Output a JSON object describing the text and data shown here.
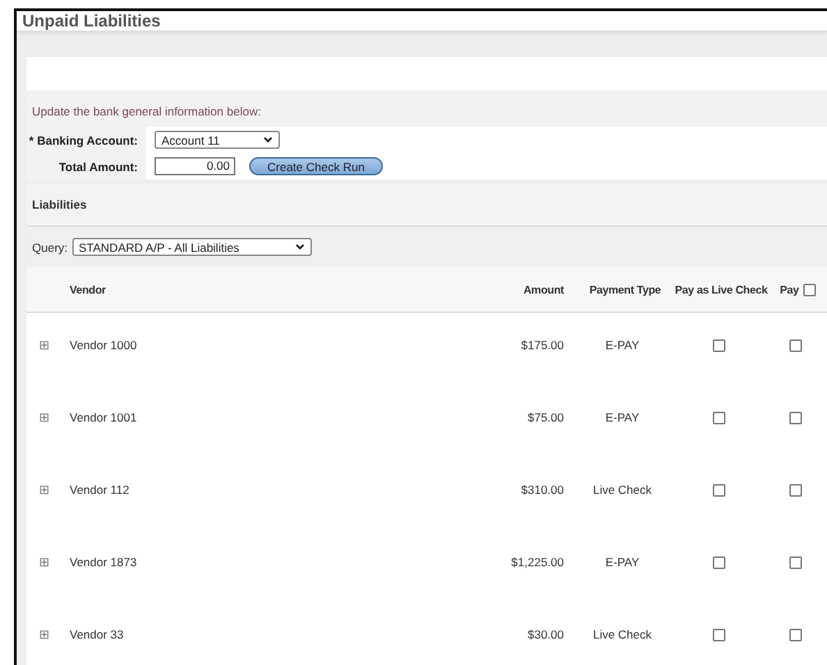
{
  "window": {
    "title": "Unpaid Liabilities"
  },
  "form": {
    "intro": "Update the bank general information below:",
    "banking_account": {
      "label": "* Banking Account:",
      "value": "Account 11"
    },
    "total_amount": {
      "label": "Total Amount:",
      "value": "0.00"
    },
    "create_button": "Create Check Run"
  },
  "section_title": "Liabilities",
  "query": {
    "label": "Query:",
    "value": "STANDARD A/P - All Liabilities"
  },
  "table": {
    "columns": [
      "Vendor",
      "Amount",
      "Payment Type",
      "Pay as Live Check",
      "Pay"
    ],
    "pay_all_checked": false,
    "rows": [
      {
        "expander": "⊞",
        "vendor": "Vendor 1000",
        "amount": "$175.00",
        "payment_type": "E-PAY",
        "live_check": false,
        "pay": false
      },
      {
        "expander": "⊞",
        "vendor": "Vendor 1001",
        "amount": "$75.00",
        "payment_type": "E-PAY",
        "live_check": false,
        "pay": false
      },
      {
        "expander": "⊞",
        "vendor": "Vendor 112",
        "amount": "$310.00",
        "payment_type": "Live Check",
        "live_check": false,
        "pay": false
      },
      {
        "expander": "⊞",
        "vendor": "Vendor 1873",
        "amount": "$1,225.00",
        "payment_type": "E-PAY",
        "live_check": false,
        "pay": false
      },
      {
        "expander": "⊞",
        "vendor": "Vendor 33",
        "amount": "$30.00",
        "payment_type": "Live Check",
        "live_check": false,
        "pay": false
      }
    ]
  }
}
